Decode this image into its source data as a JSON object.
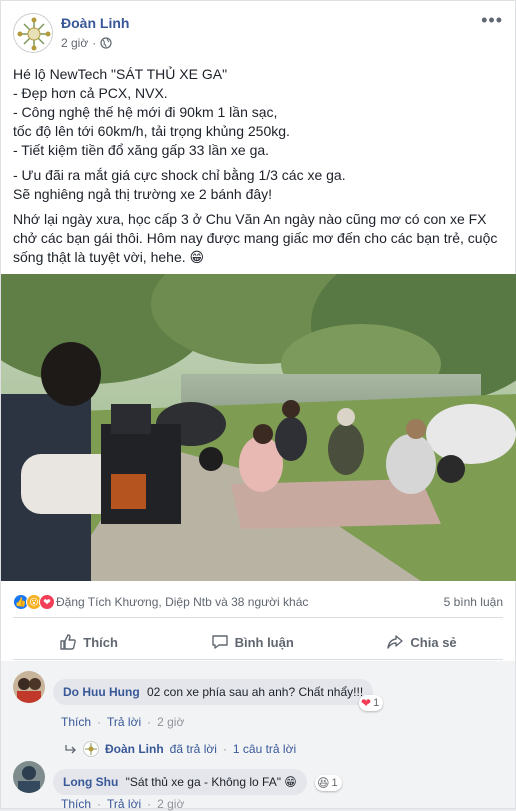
{
  "post": {
    "author": "Đoàn Linh",
    "time": "2 giờ",
    "lines": [
      "Hé lộ NewTech \"SÁT THỦ XE GA\"",
      "- Đẹp hơn cả PCX, NVX.",
      "- Công nghệ thế hệ mới đi 90km 1 lần sạc,",
      "tốc độ lên tới 60km/h, tải trọng khủng 250kg.",
      "- Tiết kiệm tiền đổ xăng gấp 33 lần xe ga.",
      "- Ưu đãi ra mắt giá cực shock chỉ bằng 1/3 các xe ga.",
      "Sẽ nghiêng ngả thị trường xe 2 bánh đây!",
      "Nhớ lại ngày xưa, học cấp 3 ở Chu Văn An ngày nào cũng mơ có con xe FX chở các bạn gái thôi. Hôm nay được mang giấc mơ đến cho các bạn trẻ, cuộc sống thật là tuyệt vời, hehe. 😁"
    ]
  },
  "reactions": {
    "summary": "Đặng Tích Khương, Diệp Ntb và 38 người khác",
    "comments": "5 bình luận"
  },
  "actions": {
    "like": "Thích",
    "comment": "Bình luận",
    "share": "Chia sẻ"
  },
  "colors": {
    "link": "#385898",
    "like_blue": "#1877f2",
    "love_red": "#f33e58",
    "haha_yellow": "#f7b125"
  },
  "comments": [
    {
      "name": "Do Huu Hung",
      "text": "02 con xe phía sau ah anh? Chất nhẩy!!!",
      "like": "Thích",
      "reply": "Trả lời",
      "time": "2 giờ",
      "reaction_count": "1",
      "replies_author": "Đoàn Linh",
      "replies_action": "đã trả lời",
      "replies_count": "1 câu trả lời"
    },
    {
      "name": "Long Shu",
      "text": "\"Sát thủ xe ga - Không lo FA\" 😁",
      "like": "Thích",
      "reply": "Trả lời",
      "time": "2 giờ",
      "reaction_count": "1"
    }
  ]
}
